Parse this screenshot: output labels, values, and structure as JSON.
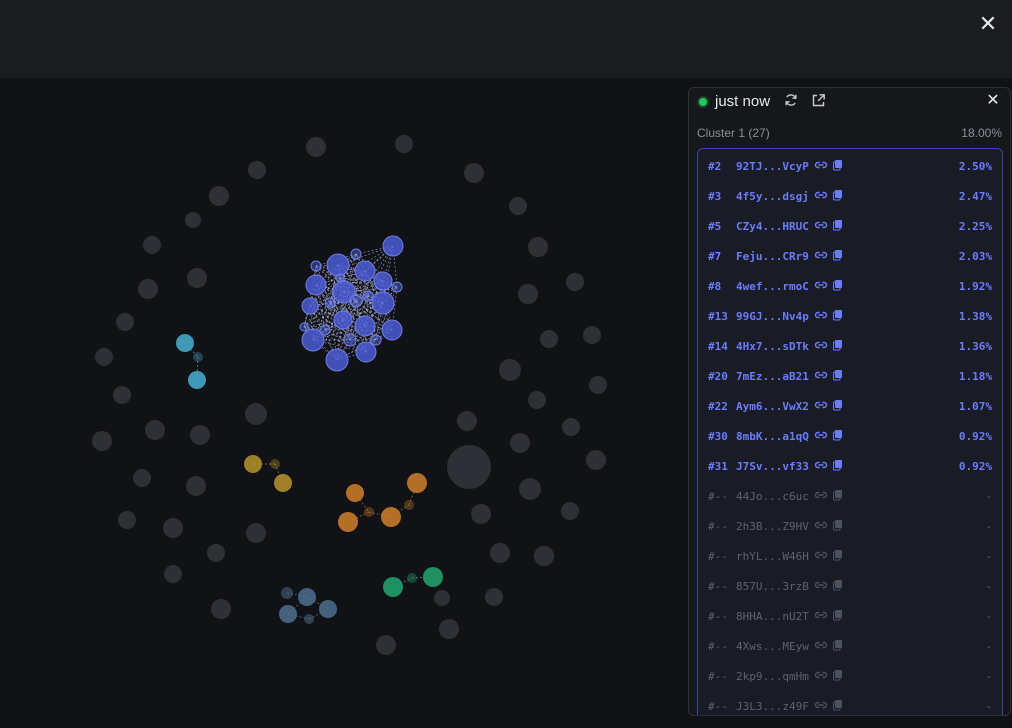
{
  "window": {
    "close_icon": "close-icon"
  },
  "panel": {
    "status_text": "just now",
    "status_color": "#22c55e",
    "refresh_icon": "refresh-icon",
    "open_external_icon": "external-link-icon",
    "close_icon": "close-icon",
    "cluster_label": "Cluster 1 (27)",
    "cluster_pct": "18.00%",
    "rows": [
      {
        "rank": "#2",
        "addr": "92TJ...VcyP",
        "pct": "2.50%",
        "active": true
      },
      {
        "rank": "#3",
        "addr": "4f5y...dsgj",
        "pct": "2.47%",
        "active": true
      },
      {
        "rank": "#5",
        "addr": "CZy4...HRUC",
        "pct": "2.25%",
        "active": true
      },
      {
        "rank": "#7",
        "addr": "Feju...CRr9",
        "pct": "2.03%",
        "active": true
      },
      {
        "rank": "#8",
        "addr": "4wef...rmoC",
        "pct": "1.92%",
        "active": true
      },
      {
        "rank": "#13",
        "addr": "99GJ...Nv4p",
        "pct": "1.38%",
        "active": true
      },
      {
        "rank": "#14",
        "addr": "4Hx7...sDTk",
        "pct": "1.36%",
        "active": true
      },
      {
        "rank": "#20",
        "addr": "7mEz...aB21",
        "pct": "1.18%",
        "active": true
      },
      {
        "rank": "#22",
        "addr": "Aym6...VwX2",
        "pct": "1.07%",
        "active": true
      },
      {
        "rank": "#30",
        "addr": "8mbK...a1qQ",
        "pct": "0.92%",
        "active": true
      },
      {
        "rank": "#31",
        "addr": "J7Sv...vf33",
        "pct": "0.92%",
        "active": true
      },
      {
        "rank": "#--",
        "addr": "44Jo...c6uc",
        "pct": "-",
        "active": false
      },
      {
        "rank": "#--",
        "addr": "2h3B...Z9HV",
        "pct": "-",
        "active": false
      },
      {
        "rank": "#--",
        "addr": "rhYL...W46H",
        "pct": "-",
        "active": false
      },
      {
        "rank": "#--",
        "addr": "857U...3rzB",
        "pct": "-",
        "active": false
      },
      {
        "rank": "#--",
        "addr": "8HHA...nU2T",
        "pct": "-",
        "active": false
      },
      {
        "rank": "#--",
        "addr": "4Xws...MEyw",
        "pct": "-",
        "active": false
      },
      {
        "rank": "#--",
        "addr": "2kp9...qmHm",
        "pct": "-",
        "active": false
      },
      {
        "rank": "#--",
        "addr": "J3L3...z49F",
        "pct": "-",
        "active": false
      }
    ]
  },
  "graph": {
    "colors": {
      "background": "#111215",
      "gray_node": "#2e3036",
      "blue_cluster": "#4a5bd4",
      "cyan_cluster": "#46a7c9",
      "yellow_cluster": "#b8932a",
      "orange_cluster": "#c77a28",
      "green_cluster": "#1fa06a",
      "steel_cluster": "#4d6f8f"
    }
  }
}
